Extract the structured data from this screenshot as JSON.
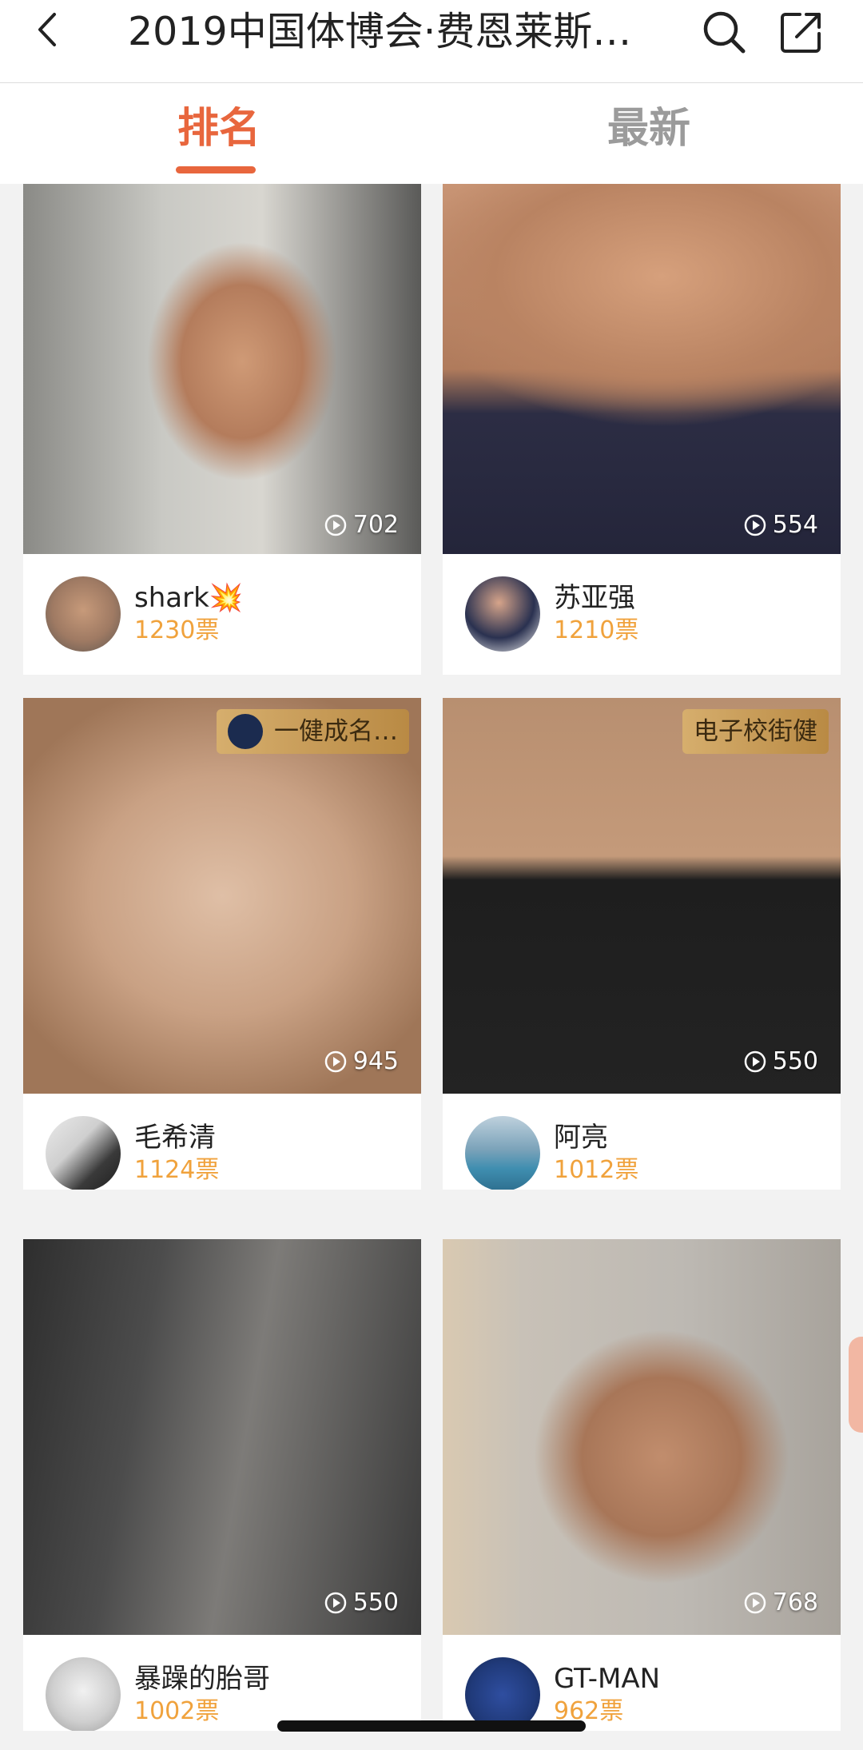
{
  "header": {
    "title": "2019中国体博会·费恩莱斯…",
    "back_icon": "chevron-left-icon",
    "search_icon": "search-icon",
    "share_icon": "share-icon"
  },
  "tabs": [
    {
      "label": "排名",
      "active": true
    },
    {
      "label": "最新",
      "active": false
    }
  ],
  "accent_color": "#e8663d",
  "vote_color": "#f0a23c",
  "cards": [
    {
      "name": "shark💥",
      "votes": "1230票",
      "plays": "702",
      "badge": ""
    },
    {
      "name": "苏亚强",
      "votes": "1210票",
      "plays": "554",
      "badge": ""
    },
    {
      "name": "毛希清",
      "votes": "1124票",
      "plays": "945",
      "badge": "一健成名…"
    },
    {
      "name": "阿亮",
      "votes": "1012票",
      "plays": "550",
      "badge": "电子校街健"
    },
    {
      "name": "暴躁的胎哥",
      "votes": "1002票",
      "plays": "550",
      "badge": ""
    },
    {
      "name": "GT-MAN",
      "votes": "962票",
      "plays": "768",
      "badge": ""
    }
  ]
}
